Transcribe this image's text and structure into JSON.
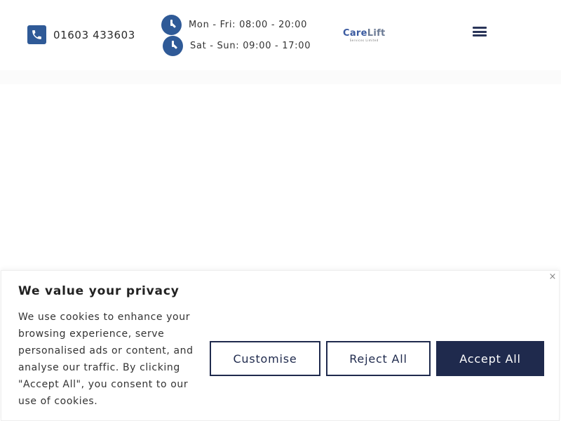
{
  "header": {
    "phone": {
      "icon": "phone-icon",
      "number": "01603 433603"
    },
    "hours": [
      {
        "icon": "clock-icon",
        "text": "Mon - Fri: 08:00 - 20:00"
      },
      {
        "icon": "clock-icon",
        "text": "Sat - Sun: 09:00 - 17:00"
      }
    ],
    "logo": {
      "care": "Care",
      "lift": "Lift",
      "subtitle": "Services Limited"
    },
    "menu": {
      "icon": "hamburger-menu-icon"
    }
  },
  "cookie_banner": {
    "title": "We value your privacy",
    "body": "We use cookies to enhance your browsing experience, serve personalised ads or content, and analyse our traffic. By clicking \"Accept All\", you consent to our use of cookies.",
    "close_icon": "×",
    "buttons": {
      "customise": "Customise",
      "reject": "Reject All",
      "accept": "Accept All"
    }
  },
  "colors": {
    "brand_blue": "#2f5a97",
    "navy": "#1f2a4d"
  }
}
